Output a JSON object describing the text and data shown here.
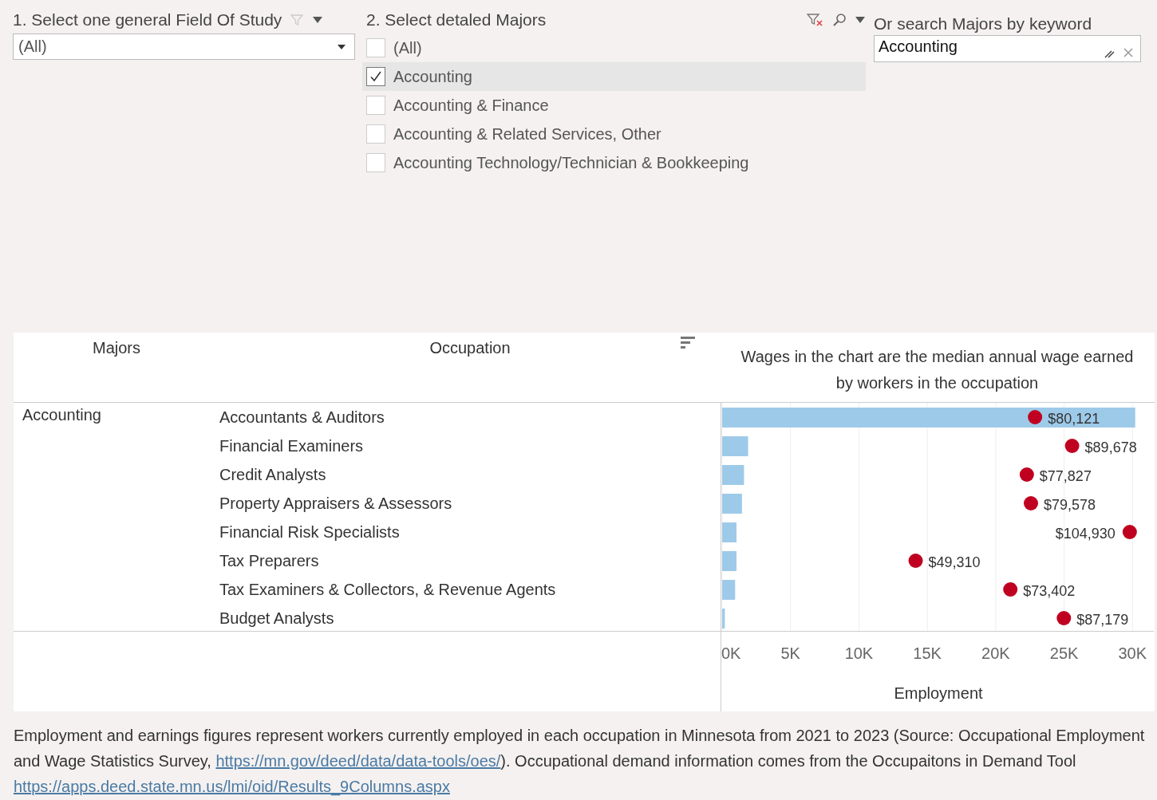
{
  "filters": {
    "field_of_study": {
      "title": "1. Select one general Field Of Study",
      "value": "(All)"
    },
    "majors": {
      "title": "2. Select detaled Majors",
      "items": [
        {
          "label": "(All)",
          "checked": false,
          "selected": false
        },
        {
          "label": "Accounting",
          "checked": true,
          "selected": true
        },
        {
          "label": "Accounting & Finance",
          "checked": false,
          "selected": false
        },
        {
          "label": "Accounting & Related Services, Other",
          "checked": false,
          "selected": false
        },
        {
          "label": "Accounting Technology/Technician & Bookkeeping",
          "checked": false,
          "selected": false
        }
      ]
    },
    "keyword": {
      "title": "Or search Majors by keyword",
      "value": "Accounting"
    }
  },
  "table": {
    "columns": [
      "Majors",
      "Occupation"
    ],
    "chart_heading": "Wages in the chart are the median annual wage earned by workers in the occupation",
    "major": "Accounting",
    "rows": [
      {
        "occupation": "Accountants & Auditors",
        "wage": "$80,121",
        "level": 0.76
      },
      {
        "occupation": "Financial Examiners",
        "wage": "$89,678",
        "level": 0.85
      },
      {
        "occupation": "Credit Analysts",
        "wage": "$77,827",
        "level": 0.74
      },
      {
        "occupation": "Property Appraisers & Assessors",
        "wage": "$79,578",
        "level": 0.75
      },
      {
        "occupation": "Financial Risk Specialists",
        "wage": "$104,930",
        "level": 0.99
      },
      {
        "occupation": "Tax Preparers",
        "wage": "$49,310",
        "level": 0.47
      },
      {
        "occupation": "Tax Examiners & Collectors, & Revenue Agents",
        "wage": "$73,402",
        "level": 0.7
      },
      {
        "occupation": "Budget Analysts",
        "wage": "$87,179",
        "level": 0.83
      }
    ],
    "chart_data": {
      "type": "bar",
      "orientation": "horizontal",
      "xlabel": "Employment",
      "grid": true,
      "xlim": [
        0,
        31500
      ],
      "xticks": [
        {
          "value": 0,
          "label": "0K"
        },
        {
          "value": 5000,
          "label": "5K"
        },
        {
          "value": 10000,
          "label": "10K"
        },
        {
          "value": 15000,
          "label": "15K"
        },
        {
          "value": 20000,
          "label": "20K"
        },
        {
          "value": 25000,
          "label": "25K"
        },
        {
          "value": 30000,
          "label": "30K"
        }
      ],
      "values": [
        30200,
        1900,
        1600,
        1450,
        1050,
        1050,
        950,
        200
      ]
    }
  },
  "footnote": {
    "text": "Employment and earnings figures represent workers currently employed in each occupation in Minnesota from 2021 to 2023 (Source: Occupational Employment and Wage Statistics Survey, ",
    "link1": "https://mn.gov/deed/data/data-tools/oes/",
    "text2": "). Occupational demand information comes from the Occupaitons in Demand Tool ",
    "link2": "https://apps.deed.state.mn.us/lmi/oid/Results_9Columns.aspx"
  }
}
